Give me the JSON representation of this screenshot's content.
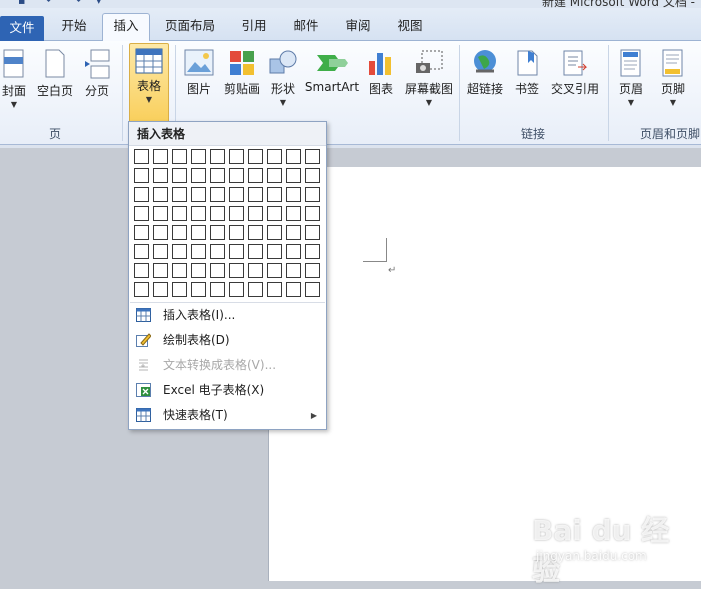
{
  "window": {
    "title": "新建 Microsoft Word 文档 -"
  },
  "tabs": {
    "file": "文件",
    "home": "开始",
    "insert": "插入",
    "page_layout": "页面布局",
    "references": "引用",
    "mailings": "邮件",
    "review": "审阅",
    "view": "视图"
  },
  "ribbon": {
    "pages": {
      "cover": "封面",
      "blank": "空白页",
      "break": "分页",
      "group": "页"
    },
    "table": {
      "label": "表格"
    },
    "illustrations": {
      "picture": "图片",
      "clipart": "剪贴画",
      "shapes": "形状",
      "smartart": "SmartArt",
      "chart": "图表",
      "screenshot": "屏幕截图"
    },
    "links": {
      "hyperlink": "超链接",
      "bookmark": "书签",
      "crossref": "交叉引用",
      "group": "链接"
    },
    "header_footer": {
      "header": "页眉",
      "footer": "页脚",
      "group": "页眉和页脚"
    }
  },
  "dropdown": {
    "header": "插入表格",
    "grid": {
      "columns": 10,
      "rows": 8
    },
    "items": [
      {
        "label": "插入表格(I)...",
        "enabled": true
      },
      {
        "label": "绘制表格(D)",
        "enabled": true
      },
      {
        "label": "文本转换成表格(V)...",
        "enabled": false
      },
      {
        "label": "Excel 电子表格(X)",
        "enabled": true
      },
      {
        "label": "快速表格(T)",
        "enabled": true
      }
    ]
  },
  "watermark": {
    "logo": "Bai du 经验",
    "url": "jingyan.baidu.com"
  },
  "colors": {
    "file_tab": "#2e64b4",
    "table_button": "#f9cf5c",
    "ribbon": "#e8eef8"
  }
}
